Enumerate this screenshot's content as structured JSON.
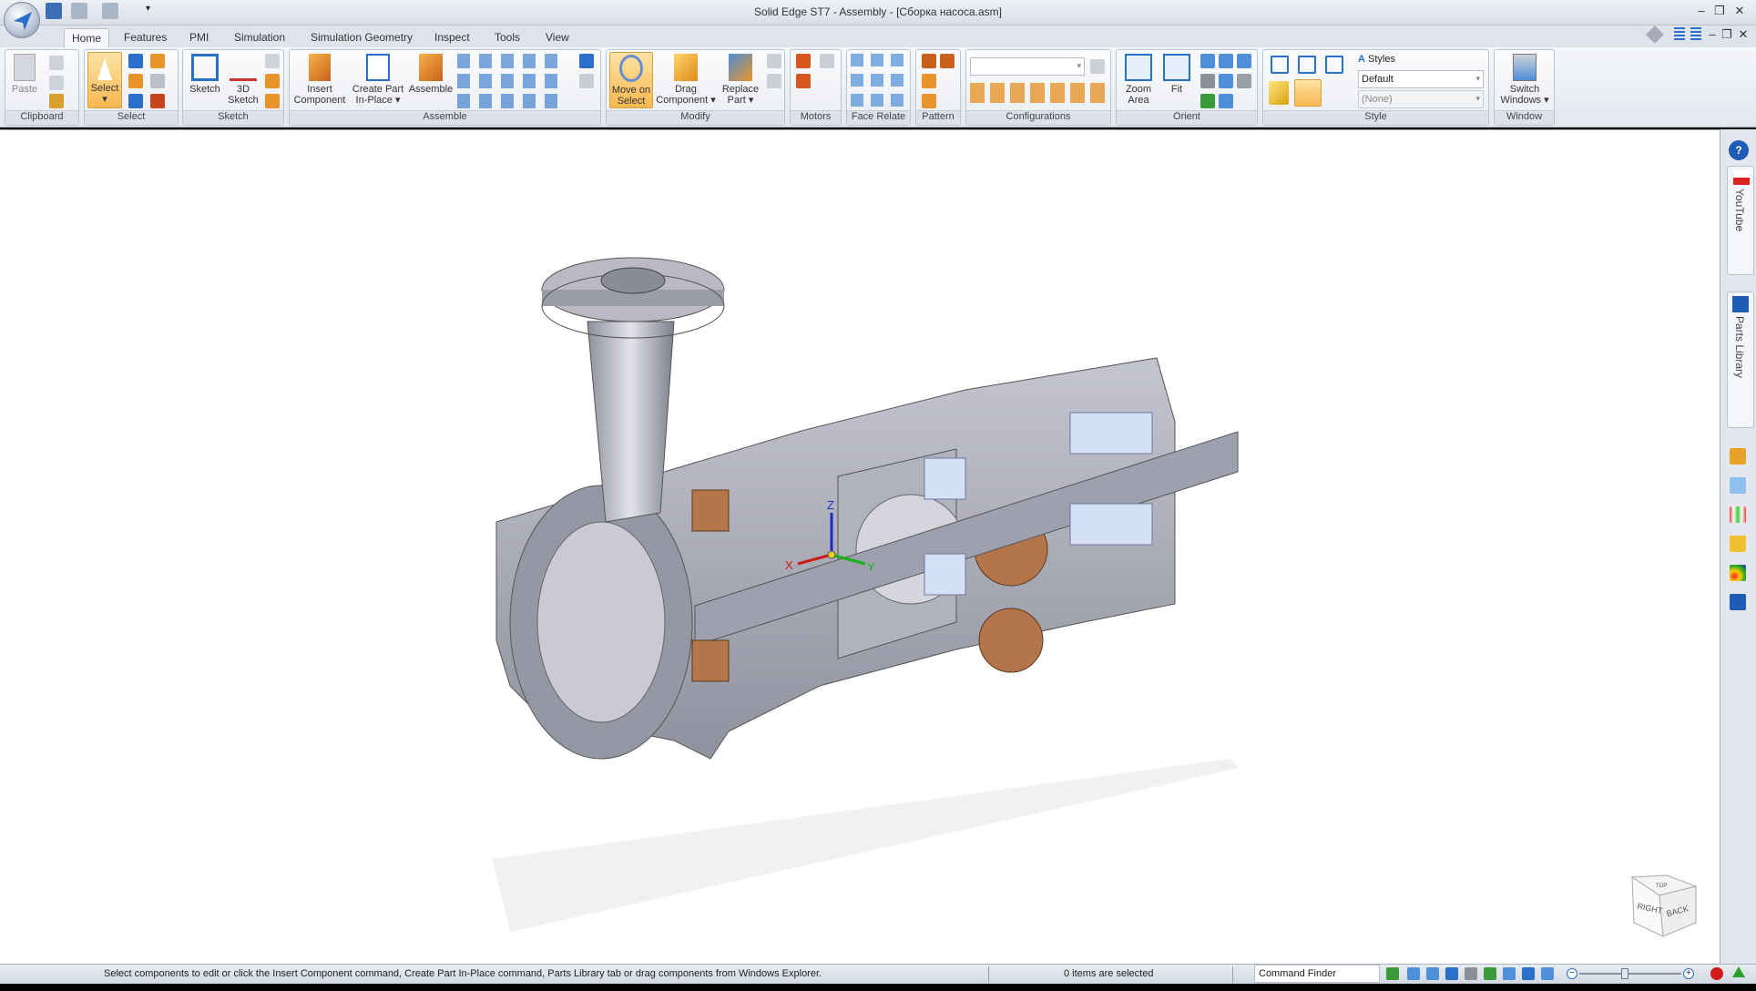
{
  "window": {
    "title": "Solid Edge ST7 - Assembly - [Сборка насоса.asm]",
    "controls": [
      "minimize",
      "restore",
      "close"
    ]
  },
  "tabs": [
    {
      "label": "Home",
      "active": true
    },
    {
      "label": "Features"
    },
    {
      "label": "PMI"
    },
    {
      "label": "Simulation"
    },
    {
      "label": "Simulation Geometry"
    },
    {
      "label": "Inspect"
    },
    {
      "label": "Tools"
    },
    {
      "label": "View"
    }
  ],
  "ribbon": {
    "groups": {
      "clipboard": "Clipboard",
      "select": "Select",
      "sketch": "Sketch",
      "assemble": "Assemble",
      "modify": "Modify",
      "motors": "Motors",
      "face_relate": "Face Relate",
      "pattern": "Pattern",
      "configurations": "Configurations",
      "orient": "Orient",
      "style": "Style",
      "window": "Window"
    },
    "buttons": {
      "paste": "Paste",
      "select": "Select",
      "sketch": "Sketch",
      "sketch3d_1": "3D",
      "sketch3d_2": "Sketch",
      "insert_1": "Insert",
      "insert_2": "Component",
      "create_1": "Create Part",
      "create_2": "In-Place ▾",
      "assemble": "Assemble",
      "move_1": "Move on",
      "move_2": "Select",
      "drag_1": "Drag",
      "drag_2": "Component ▾",
      "replace_1": "Replace",
      "replace_2": "Part ▾",
      "zoom_1": "Zoom",
      "zoom_2": "Area",
      "fit": "Fit",
      "styles": "Styles",
      "switch_1": "Switch",
      "switch_2": "Windows ▾"
    },
    "style_select": "Default",
    "style_none": "(None)",
    "config_select": ""
  },
  "right_panel": {
    "youtube": "YouTube",
    "parts_library": "Parts Library"
  },
  "viewcube": {
    "faces": [
      "RIGHT",
      "BACK",
      "TOP"
    ]
  },
  "triad": {
    "x": "X",
    "y": "Y",
    "z": "Z"
  },
  "status": {
    "message": "Select components to edit or click the Insert Component command, Create Part In-Place command, Parts Library tab or drag components from Windows Explorer.",
    "selection": "0 items are selected",
    "command_finder": "Command Finder"
  },
  "colors": {
    "highlight": "#f8b850",
    "model": "#a9abb8",
    "bronze": "#b5754a",
    "bearing": "#d6e0f5"
  }
}
